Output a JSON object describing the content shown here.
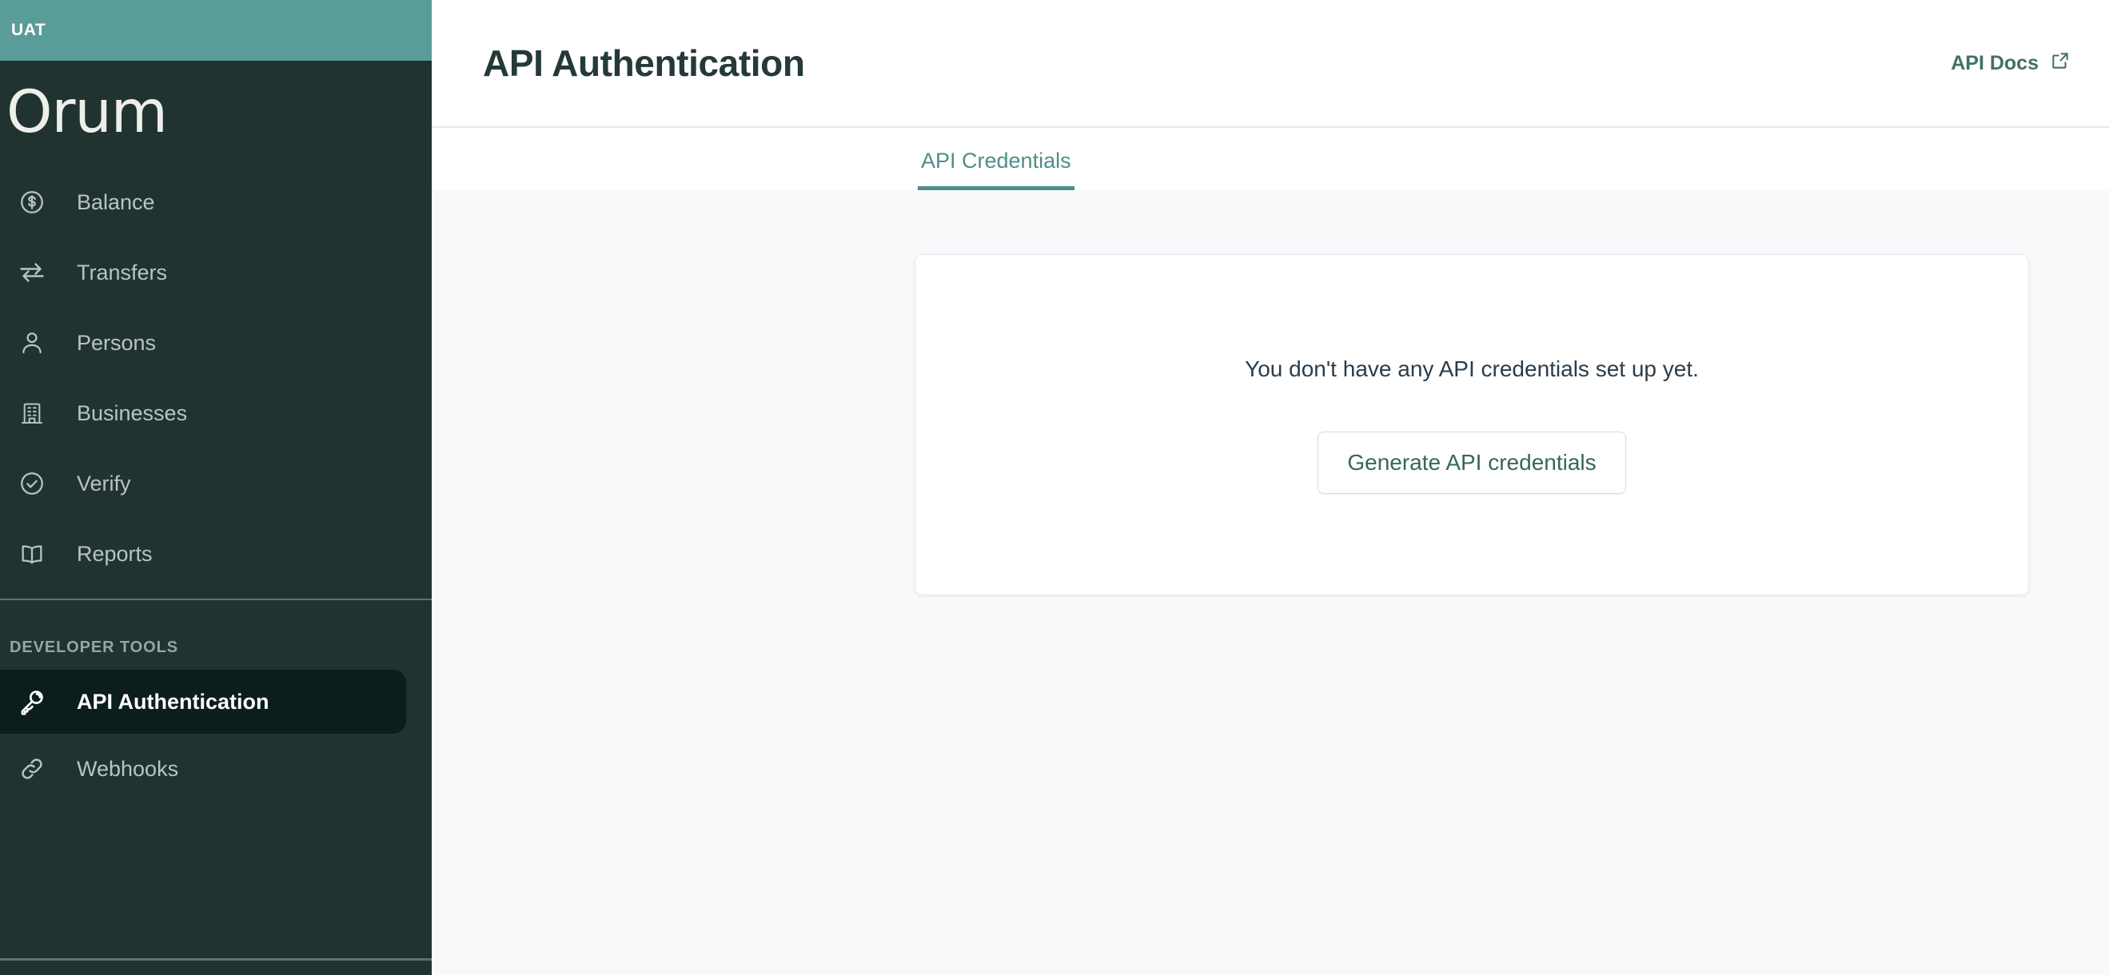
{
  "sidebar": {
    "env_badge": "UAT",
    "brand": "Orum",
    "primary_items": [
      {
        "label": "Balance",
        "icon": "dollar-circle-icon",
        "active": false
      },
      {
        "label": "Transfers",
        "icon": "transfer-arrows-icon",
        "active": false
      },
      {
        "label": "Persons",
        "icon": "person-icon",
        "active": false
      },
      {
        "label": "Businesses",
        "icon": "building-icon",
        "active": false
      },
      {
        "label": "Verify",
        "icon": "check-circle-icon",
        "active": false
      },
      {
        "label": "Reports",
        "icon": "book-icon",
        "active": false
      }
    ],
    "section_label": "DEVELOPER TOOLS",
    "developer_items": [
      {
        "label": "API Authentication",
        "icon": "key-icon",
        "active": true
      },
      {
        "label": "Webhooks",
        "icon": "link-icon",
        "active": false
      }
    ]
  },
  "header": {
    "title": "API Authentication",
    "api_docs_label": "API Docs",
    "api_docs_icon": "external-link-icon"
  },
  "tabs": [
    {
      "label": "API Credentials",
      "active": true
    }
  ],
  "main": {
    "empty_message": "You don't have any API credentials set up yet.",
    "generate_button_label": "Generate API credentials"
  },
  "colors": {
    "env_bar": "#5a9c97",
    "sidebar_bg": "#213331",
    "sidebar_active_bg": "#0b1e1c",
    "accent_teal": "#4e8e87",
    "link_teal": "#427068",
    "page_bg": "#f8f9fb",
    "title_dark": "#24393a"
  }
}
